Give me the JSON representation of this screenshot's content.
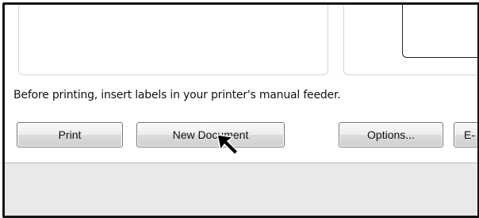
{
  "instruction": "Before printing, insert labels in your printer's manual feeder.",
  "buttons": {
    "print": "Print",
    "new_document": "New Document",
    "options": "Options...",
    "e_partial": "E-"
  },
  "icons": {
    "cursor": "arrow-pointer-icon"
  }
}
